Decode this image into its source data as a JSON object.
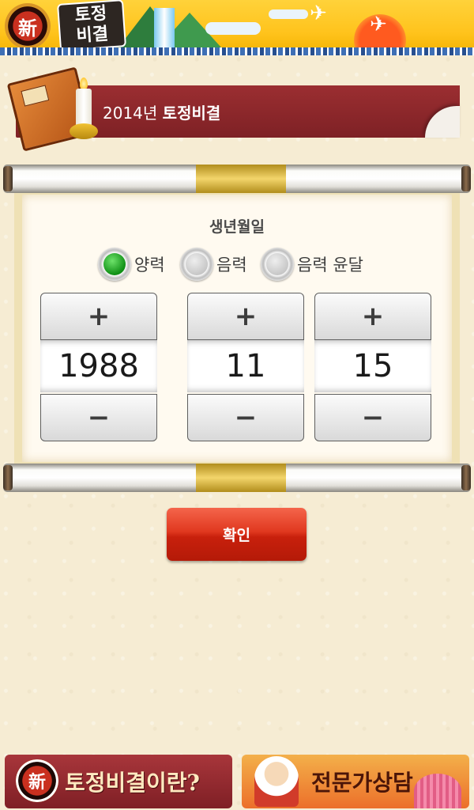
{
  "header": {
    "logo_char": "新",
    "logo_title_line1": "토정",
    "logo_title_line2": "비결"
  },
  "title_bar": {
    "year": "2014년",
    "title": "토정비결"
  },
  "form": {
    "birth_label": "생년월일",
    "calendar_options": [
      {
        "label": "양력",
        "selected": true
      },
      {
        "label": "음력",
        "selected": false
      },
      {
        "label": "음력 윤달",
        "selected": false
      }
    ],
    "pickers": [
      {
        "name": "year",
        "value": "1988",
        "plus": "+",
        "minus": "−"
      },
      {
        "name": "month",
        "value": "11",
        "plus": "+",
        "minus": "−"
      },
      {
        "name": "day",
        "value": "15",
        "plus": "+",
        "minus": "−"
      }
    ],
    "confirm_label": "확인"
  },
  "banners": {
    "left_badge": "新",
    "left_text": "토정비결이란?",
    "right_text": "전문가상담"
  },
  "colors": {
    "title_bar": "#8a262a",
    "confirm": "#d62d15",
    "radio_selected": "#1f9a22"
  }
}
